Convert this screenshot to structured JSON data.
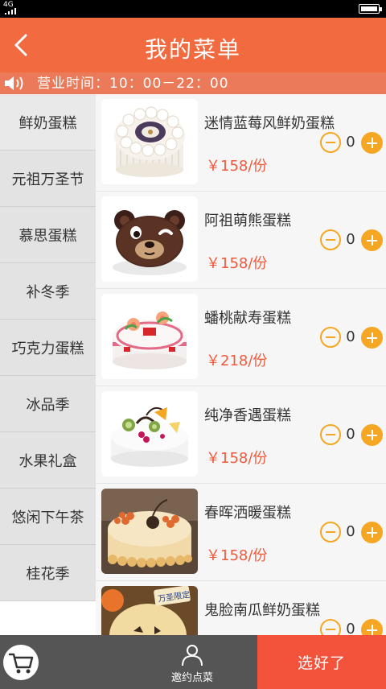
{
  "status_bar": {
    "network": "4G"
  },
  "header": {
    "title": "我的菜单"
  },
  "notice": {
    "text": "营业时间：10：00－22：00"
  },
  "categories": [
    "鲜奶蛋糕",
    "元祖万圣节",
    "慕思蛋糕",
    "补冬季",
    "巧克力蛋糕",
    "冰品季",
    "水果礼盒",
    "悠闲下午茶",
    "桂花季"
  ],
  "items": [
    {
      "name": "迷情蓝莓风鲜奶蛋糕",
      "price": "￥158/份",
      "qty": "0"
    },
    {
      "name": "阿祖萌熊蛋糕",
      "price": "￥158/份",
      "qty": "0"
    },
    {
      "name": "蟠桃献寿蛋糕",
      "price": "￥218/份",
      "qty": "0"
    },
    {
      "name": "纯净香遇蛋糕",
      "price": "￥158/份",
      "qty": "0"
    },
    {
      "name": "春晖洒暖蛋糕",
      "price": "￥158/份",
      "qty": "0"
    },
    {
      "name": "鬼脸南瓜鲜奶蛋糕",
      "price": "",
      "qty": "0",
      "badge": "万圣限定"
    }
  ],
  "bottom_bar": {
    "invite_label": "邀约点菜",
    "confirm_label": "选好了"
  },
  "colors": {
    "header": "#f26a3f",
    "accent": "#f5a623",
    "price": "#f2593b",
    "confirm": "#f2533a",
    "bottom": "#555555"
  }
}
